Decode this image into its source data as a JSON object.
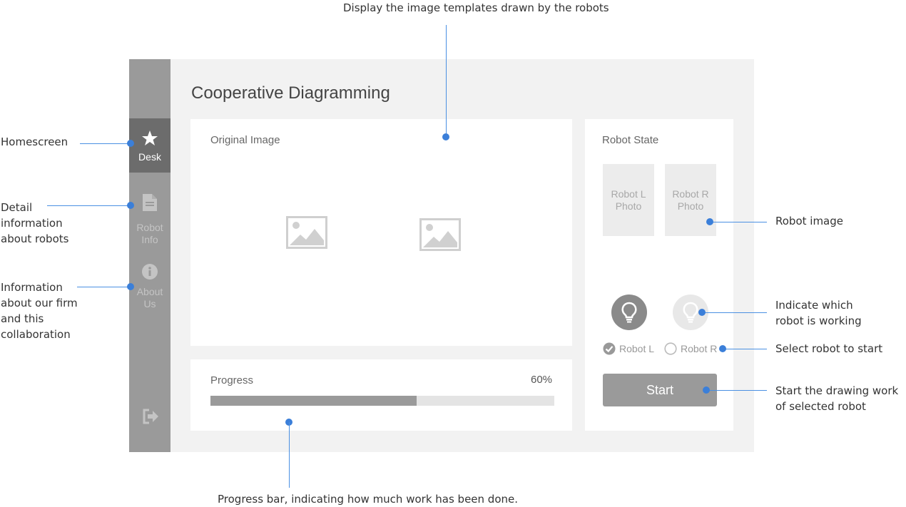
{
  "app": {
    "title": "Cooperative Diagramming",
    "sidebar": {
      "items": [
        {
          "label": "Desk",
          "icon": "star-icon",
          "active": true
        },
        {
          "label": "Robot\nInfo",
          "icon": "document-icon",
          "active": false
        },
        {
          "label": "About\nUs",
          "icon": "info-icon",
          "active": false
        }
      ],
      "logout_icon": "logout-icon"
    },
    "original_image": {
      "title": "Original Image",
      "images": [
        "image-placeholder-icon",
        "image-placeholder-icon"
      ]
    },
    "progress": {
      "title": "Progress",
      "value_text": "60%",
      "value": 0.6
    },
    "robot_state": {
      "title": "Robot State",
      "photos": [
        "Robot L\nPhoto",
        "Robot R\nPhoto"
      ],
      "bulbs": [
        {
          "icon": "lightbulb-icon",
          "active": true
        },
        {
          "icon": "lightbulb-icon",
          "active": false
        }
      ],
      "options": [
        {
          "label": "Robot L",
          "checked": true
        },
        {
          "label": "Robot R",
          "checked": false
        }
      ],
      "start_label": "Start"
    }
  },
  "annotations": {
    "top": "Display the image templates drawn by the robots",
    "homescreen": "Homescreen",
    "robot_info": "Detail\ninformation\nabout robots",
    "about": "Information\nabout our firm\nand this\ncollaboration",
    "robot_image": "Robot image",
    "working": "Indicate which\nrobot is working",
    "select": "Select robot to start",
    "start": "Start the drawing work\nof selected robot",
    "progress": "Progress bar, indicating how much work has been done."
  },
  "colors": {
    "sidebar": "#9a9a9a",
    "sidebar_active": "#6c6c6c",
    "background": "#f2f2f2",
    "annotation_line": "#4a90e2"
  }
}
